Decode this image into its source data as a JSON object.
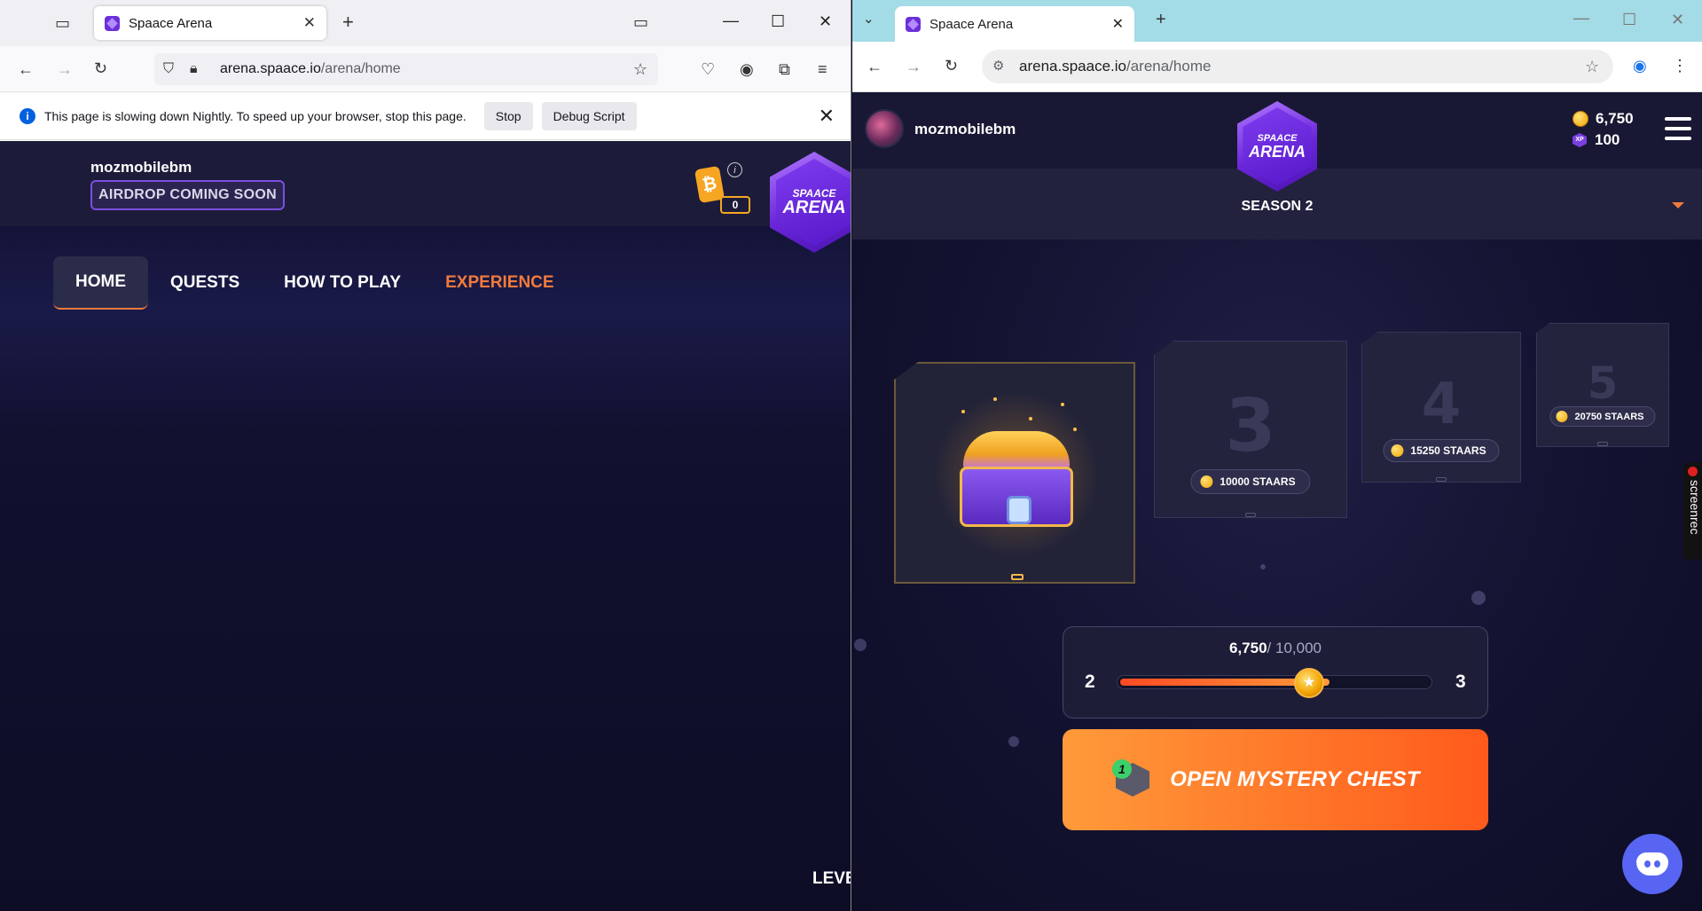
{
  "left_window": {
    "tab_title": "Spaace Arena",
    "url_host": "arena.spaace.io",
    "url_path": "/arena/home",
    "notification": {
      "message": "This page is slowing down Nightly. To speed up your browser, stop this page.",
      "stop_label": "Stop",
      "debug_label": "Debug Script"
    },
    "page": {
      "username": "mozmobilebm",
      "airdrop_badge": "AIRDROP COMING SOON",
      "btc_count": "0",
      "logo_top": "SPAACE",
      "logo_bottom": "ARENA",
      "nav": [
        "HOME",
        "QUESTS",
        "HOW TO PLAY",
        "EXPERIENCE"
      ],
      "partial_label": "LEVE"
    }
  },
  "right_window": {
    "tab_title": "Spaace Arena",
    "url_host": "arena.spaace.io",
    "url_path": "/arena/home",
    "page": {
      "username": "mozmobilebm",
      "coins": "6,750",
      "xp": "100",
      "xp_badge": "XP",
      "logo_top": "SPAACE",
      "logo_bottom": "ARENA",
      "season": "SEASON 2",
      "chests": [
        {
          "level": "3",
          "cost": "10000 STAARS"
        },
        {
          "level": "4",
          "cost": "15250 STAARS"
        },
        {
          "level": "5",
          "cost": "20750 STAARS"
        }
      ],
      "progress": {
        "current": "6,750",
        "target": "/ 10,000",
        "fraction": 0.675,
        "from_level": "2",
        "to_level": "3"
      },
      "open_button": "OPEN MYSTERY CHEST",
      "open_badge_count": "1",
      "screenrec_label": "screenrec"
    }
  }
}
